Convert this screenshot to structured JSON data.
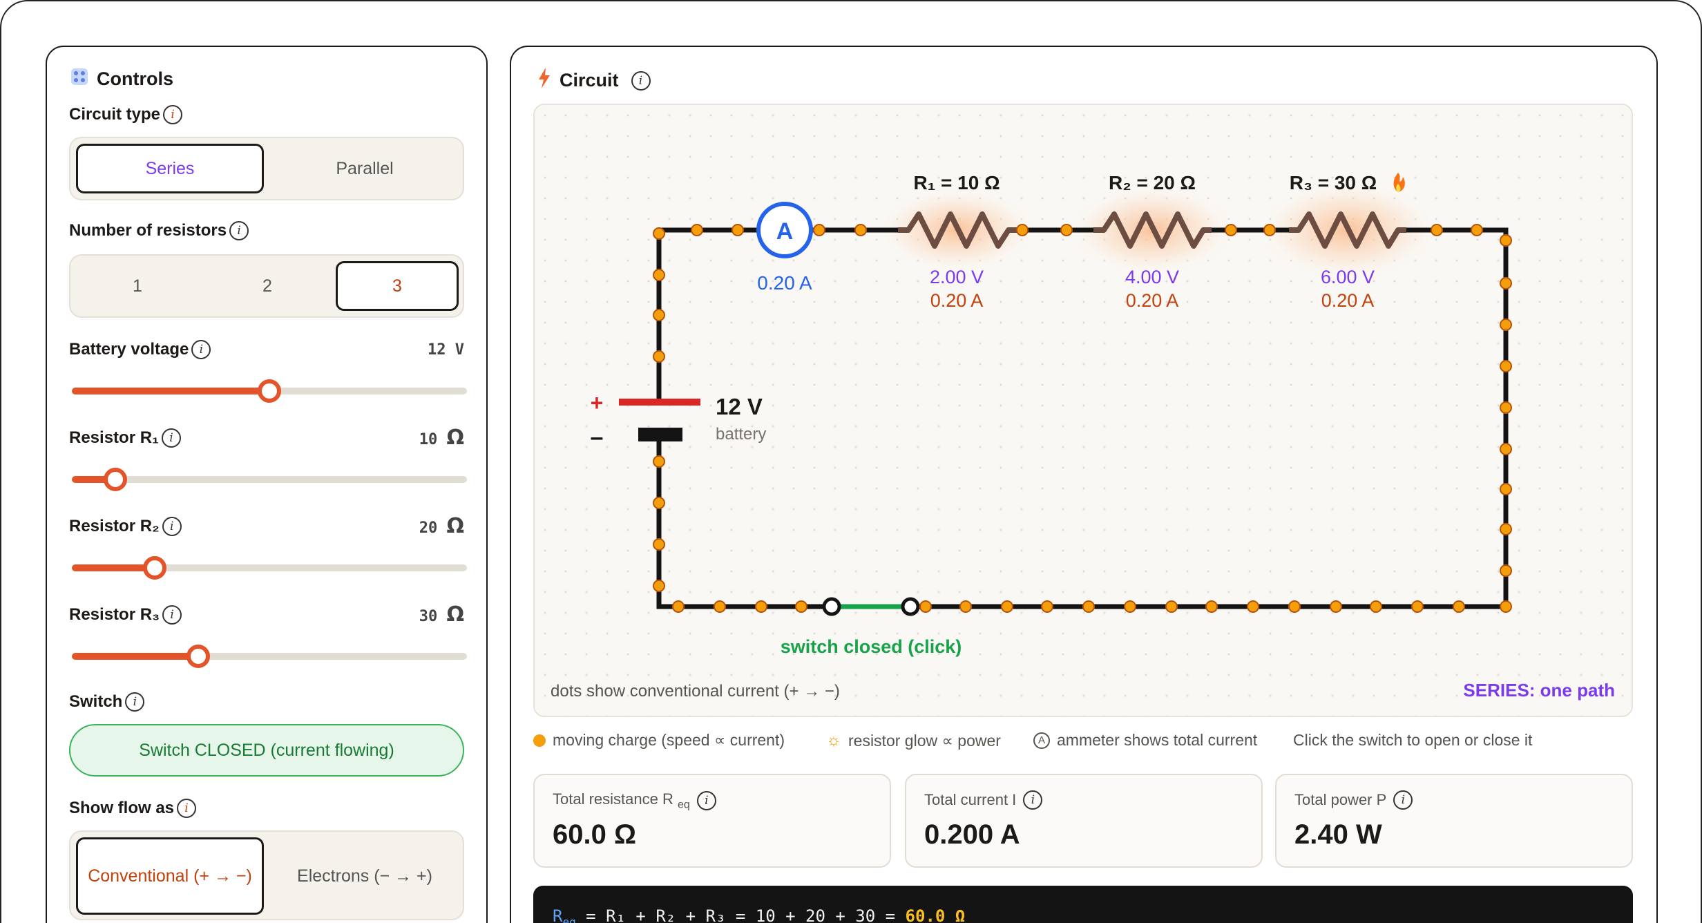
{
  "controls": {
    "title": "Controls",
    "circuit_type": {
      "label": "Circuit type",
      "options": [
        "Series",
        "Parallel"
      ],
      "selected": "Series"
    },
    "num_resistors": {
      "label": "Number of resistors",
      "options": [
        "1",
        "2",
        "3"
      ],
      "selected": "3"
    },
    "battery": {
      "label": "Battery voltage",
      "value": "12",
      "unit": "V",
      "level": 0.5
    },
    "r1": {
      "label": "Resistor R₁",
      "value": "10",
      "unit": "Ω",
      "level": 0.11
    },
    "r2": {
      "label": "Resistor R₂",
      "value": "20",
      "unit": "Ω",
      "level": 0.21
    },
    "r3": {
      "label": "Resistor R₃",
      "value": "30",
      "unit": "Ω",
      "level": 0.32
    },
    "switch": {
      "label": "Switch",
      "button": "Switch CLOSED (current flowing)"
    },
    "flow": {
      "label": "Show flow as",
      "options": [
        "Conventional (+ → −)",
        "Electrons (− → +)"
      ],
      "selected": "Conventional (+ → −)"
    }
  },
  "circuit": {
    "title": "Circuit",
    "battery_voltage": "12 V",
    "battery_label": "battery",
    "plus": "+",
    "minus": "–",
    "ammeter_symbol": "A",
    "ammeter_reading": "0.20 A",
    "resistors": [
      {
        "label": "R₁ = 10 Ω",
        "voltage": "2.00 V",
        "current": "0.20 A"
      },
      {
        "label": "R₂ = 20 Ω",
        "voltage": "4.00 V",
        "current": "0.20 A"
      },
      {
        "label": "R₃ = 30 Ω",
        "voltage": "6.00 V",
        "current": "0.20 A"
      }
    ],
    "switch_label": "switch closed (click)",
    "footer_left": "dots show conventional current (+ → −)",
    "footer_right": "SERIES: one path"
  },
  "legend": {
    "dot": "moving charge (speed ∝ current)",
    "glow": "resistor glow ∝ power",
    "ammeter": "ammeter shows total current",
    "hint": "Click the switch to open or close it"
  },
  "stats": [
    {
      "label": "Total resistance R",
      "sub": "eq",
      "value": "60.0 Ω"
    },
    {
      "label": "Total current I",
      "sub": "",
      "value": "0.200 A"
    },
    {
      "label": "Total power P",
      "sub": "",
      "value": "2.40 W"
    }
  ],
  "formula": {
    "lhs": "R",
    "lhs_sub": "eq",
    "body": " = R₁ + R₂ + R₃ = 10 + 20 + 30 = ",
    "result": "60.0 Ω"
  },
  "colors": {
    "accent": "#e4542a",
    "current": "#c2410c",
    "voltage": "#7c3aed",
    "ammeter": "#2563eb",
    "switch_on": "#16a34a",
    "dot": "#f59e0b"
  },
  "icons": [
    "grid-icon",
    "bolt-icon",
    "info-icon",
    "fire-icon",
    "sun-icon",
    "ammeter-icon"
  ]
}
